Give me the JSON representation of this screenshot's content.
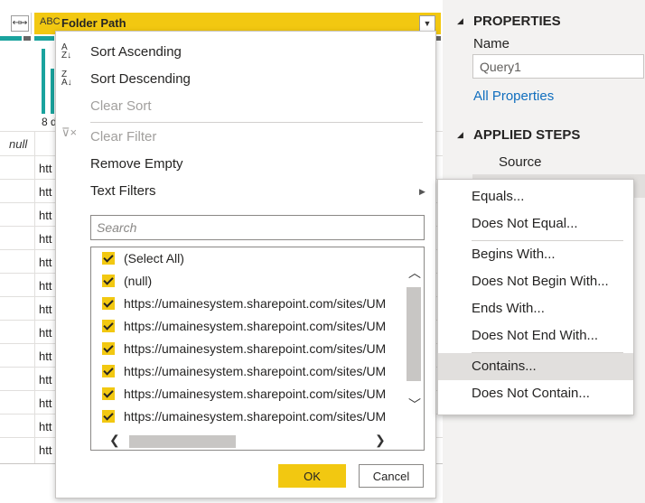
{
  "grid": {
    "column_header": {
      "type_icon": "ABC",
      "label": "Folder Path"
    },
    "distribution_label": "8 d",
    "null_cell": "null",
    "cell_prefix": "htt",
    "colors": {
      "header_accent": "#f2c811",
      "quality_valid": "#1aa39e"
    }
  },
  "filter_menu": {
    "sort_ascending": "Sort Ascending",
    "sort_descending": "Sort Descending",
    "clear_sort": "Clear Sort",
    "clear_filter": "Clear Filter",
    "remove_empty": "Remove Empty",
    "text_filters": "Text Filters",
    "search_placeholder": "Search",
    "values": [
      {
        "label": "(Select All)",
        "checked": true
      },
      {
        "label": "(null)",
        "checked": true
      },
      {
        "label": "https://umainesystem.sharepoint.com/sites/UM",
        "checked": true
      },
      {
        "label": "https://umainesystem.sharepoint.com/sites/UM",
        "checked": true
      },
      {
        "label": "https://umainesystem.sharepoint.com/sites/UM",
        "checked": true
      },
      {
        "label": "https://umainesystem.sharepoint.com/sites/UM",
        "checked": true
      },
      {
        "label": "https://umainesystem.sharepoint.com/sites/UM",
        "checked": true
      },
      {
        "label": "https://umainesystem.sharepoint.com/sites/UM",
        "checked": true
      }
    ],
    "ok": "OK",
    "cancel": "Cancel"
  },
  "text_filters_submenu": {
    "items": [
      "Equals...",
      "Does Not Equal...",
      "Begins With...",
      "Does Not Begin With...",
      "Ends With...",
      "Does Not End With...",
      "Contains...",
      "Does Not Contain..."
    ],
    "highlighted": "Contains..."
  },
  "properties_pane": {
    "heading": "PROPERTIES",
    "name_label": "Name",
    "name_value": "Query1",
    "all_properties": "All Properties"
  },
  "applied_steps": {
    "heading": "APPLIED STEPS",
    "steps": [
      "Source",
      ""
    ]
  }
}
